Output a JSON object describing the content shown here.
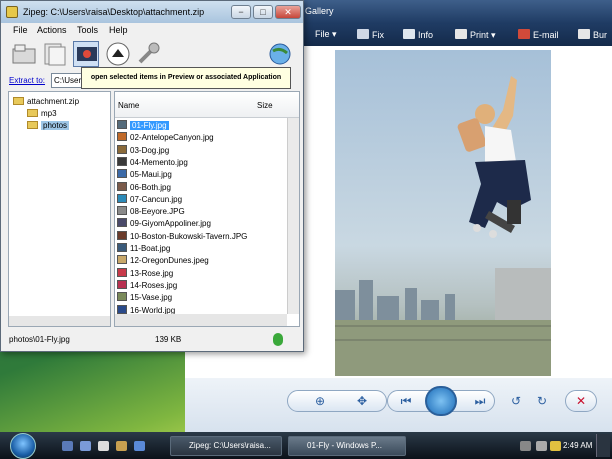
{
  "gallery": {
    "title": "Gallery",
    "toolbar": [
      "File ▾",
      "Fix",
      "Info",
      "Print ▾",
      "E-mail",
      "Bur"
    ],
    "photo_alt": "01-Fly"
  },
  "zipeg": {
    "title": "Zipeg: C:\\Users\\raisa\\Desktop\\attachment.zip",
    "menu": [
      "File",
      "Actions",
      "Tools",
      "Help"
    ],
    "tooltip": "open selected items in Preview or associated Application",
    "extract_label": "Extract to:",
    "extract_value": "C:\\User",
    "tree": {
      "root": "attachment.zip",
      "children": [
        "mp3",
        "photos"
      ],
      "selected": "photos"
    },
    "list": {
      "columns": [
        "Name",
        "Size"
      ],
      "rows": [
        {
          "name": "01-Fly.jpg",
          "selected": true,
          "color": "#556b7a"
        },
        {
          "name": "02-AntelopeCanyon.jpg",
          "color": "#c06a2a"
        },
        {
          "name": "03-Dog.jpg",
          "color": "#8a6a3a"
        },
        {
          "name": "04-Memento.jpg",
          "color": "#3a3a3a"
        },
        {
          "name": "05-Maui.jpg",
          "color": "#3b6aa8"
        },
        {
          "name": "06-Both.jpg",
          "color": "#7a5a4a"
        },
        {
          "name": "07-Cancun.jpg",
          "color": "#2b8ab8"
        },
        {
          "name": "08-Eeyore.JPG",
          "color": "#8a8a8a"
        },
        {
          "name": "09-GiyomAppoliner.jpg",
          "color": "#4a4a6a"
        },
        {
          "name": "10-Boston-Bukowski-Tavern.JPG",
          "color": "#6a3a2a"
        },
        {
          "name": "11-Boat.jpg",
          "color": "#3a5a7a"
        },
        {
          "name": "12-OregonDunes.jpeg",
          "color": "#c8a86a"
        },
        {
          "name": "13-Rose.jpg",
          "color": "#c83a4a"
        },
        {
          "name": "14-Roses.jpg",
          "color": "#b83050"
        },
        {
          "name": "15-Vase.jpg",
          "color": "#7a8a5a"
        },
        {
          "name": "16-World.jpg",
          "color": "#2a4a8a"
        }
      ]
    },
    "status_path": "photos\\01-Fly.jpg",
    "status_size": "139 KB"
  },
  "taskbar": {
    "tasks": [
      "Zipeg: C:\\Users\\raisa...",
      "01-Fly - Windows P..."
    ],
    "clock": "2:49 AM"
  }
}
